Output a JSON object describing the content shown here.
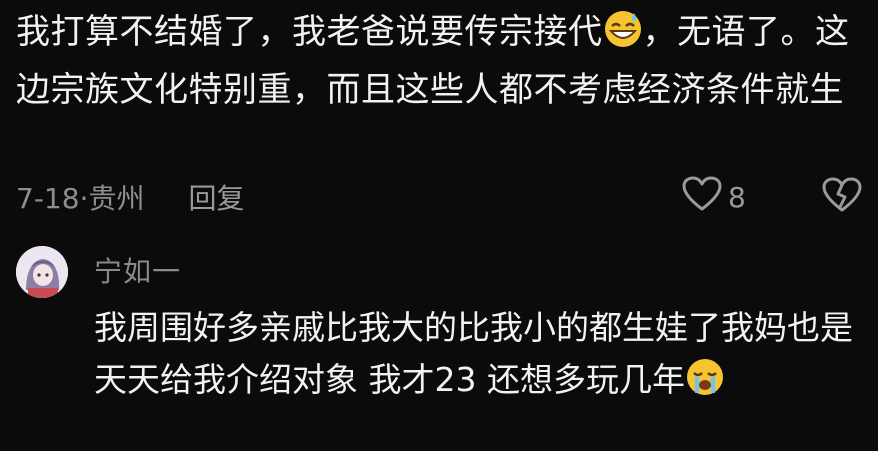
{
  "comment": {
    "text_line_1a": "我打算不结婚了，我老爸说要传宗接代",
    "text_line_1b": "，无语",
    "text_rest": "了。这边宗族文化特别重，而且这些人都不考虑经济条件就生",
    "date": "7-18",
    "location": "贵州",
    "reply_label": "回复",
    "like_count": "8"
  },
  "reply": {
    "author": "宁如一",
    "text": "我周围好多亲戚比我大的比我小的都生娃了我妈也是天天给我介绍对象 我才23 还想多玩几年"
  },
  "icons": {
    "emoji_1": "grinning-sweat-emoji",
    "emoji_2": "loudly-crying-emoji",
    "like": "heart-outline-icon",
    "dislike": "broken-heart-icon"
  }
}
